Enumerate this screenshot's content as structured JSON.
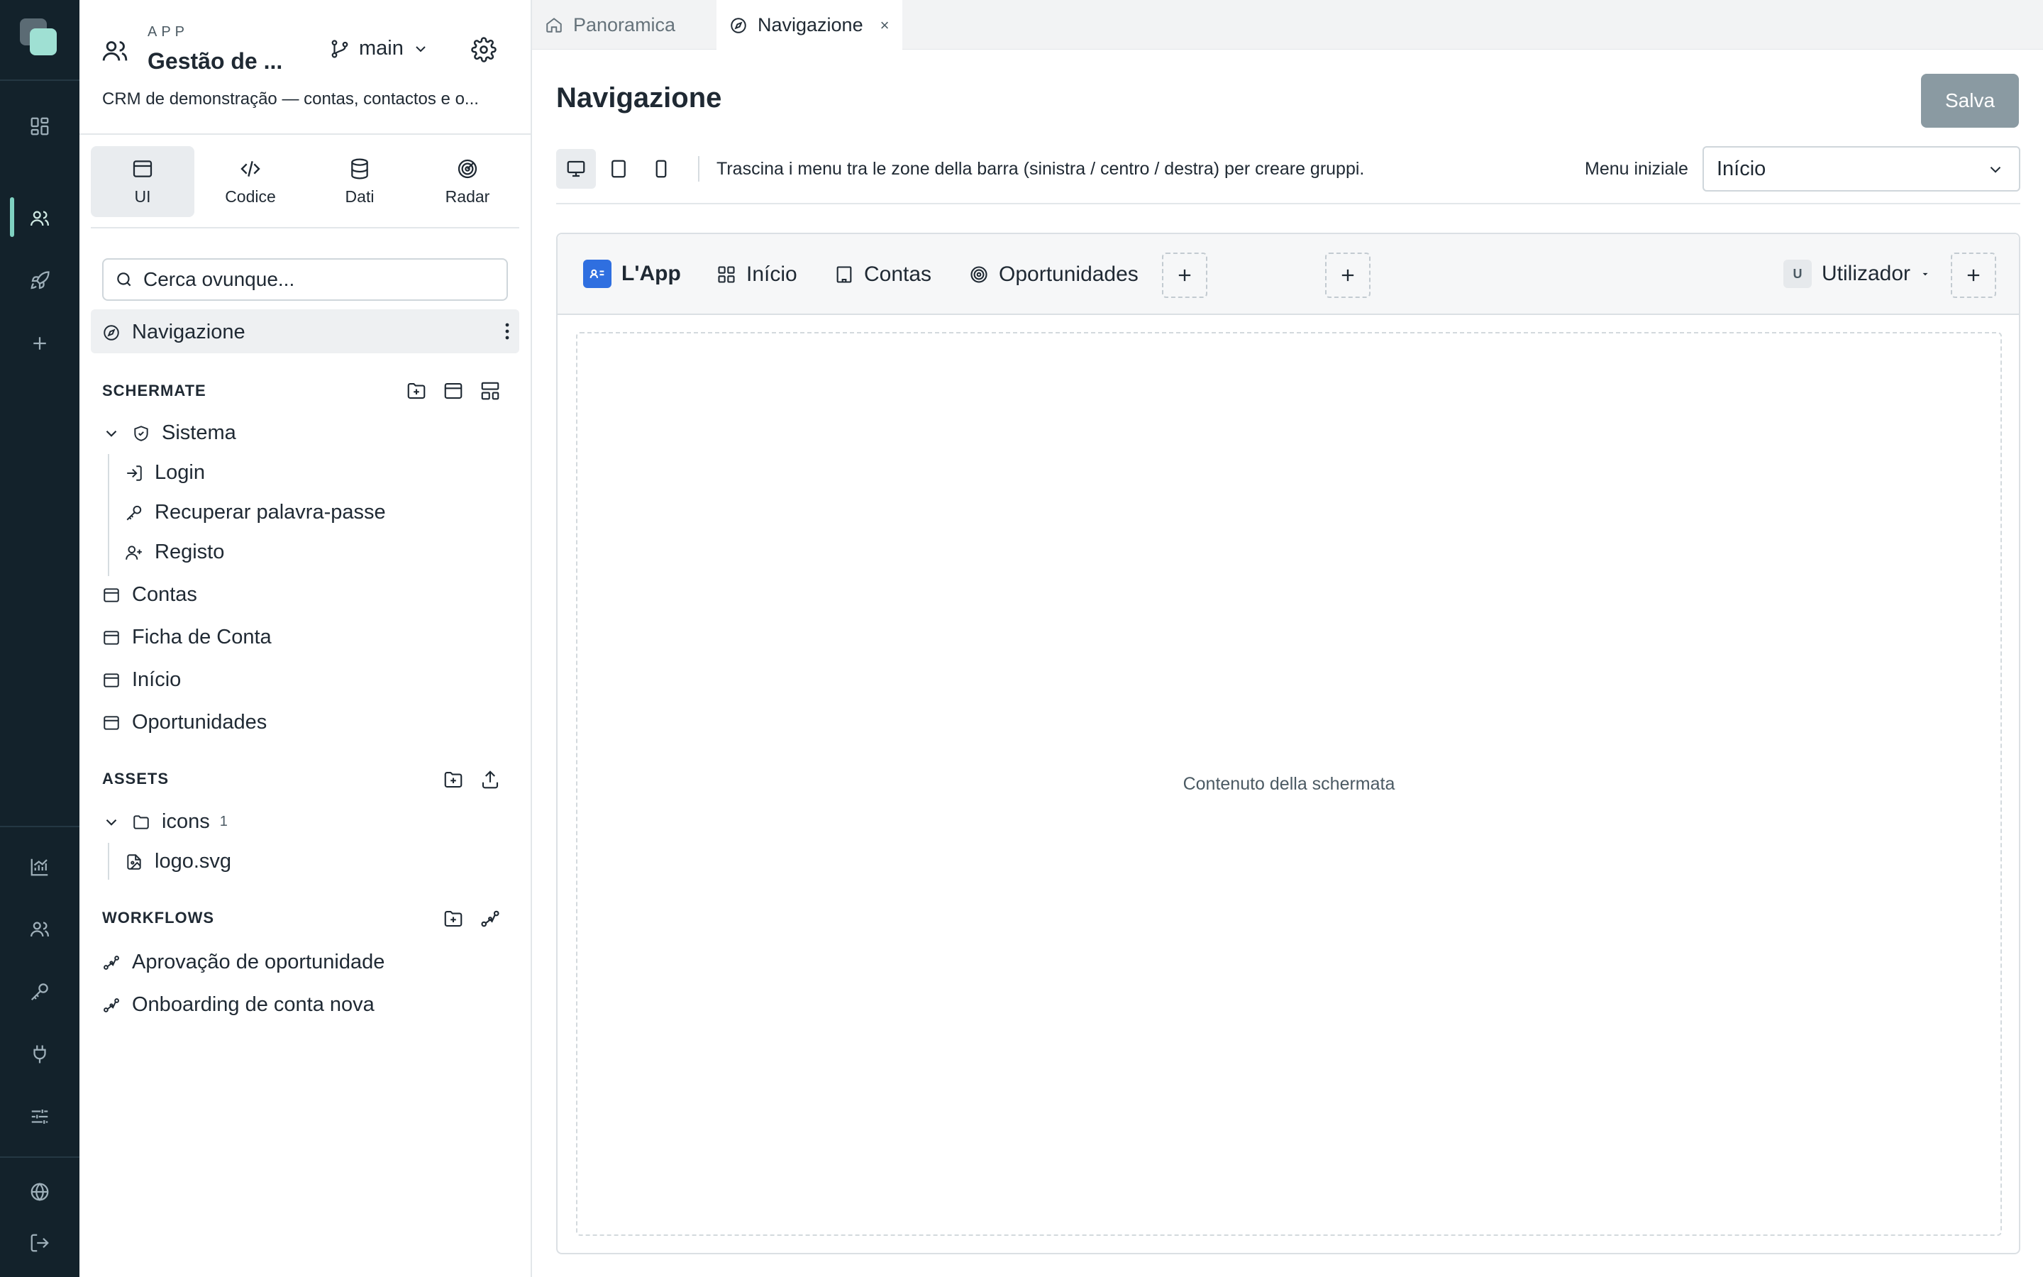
{
  "window": {
    "accent": "#7fd1c1",
    "rail_bg": "#13222b"
  },
  "app": {
    "eyebrow": "APP",
    "name": "Gestão de ...",
    "description": "CRM de demonstração — contas, contactos e o...",
    "branch": "main"
  },
  "sidebar_tabs": [
    {
      "label": "UI",
      "icon": "window-icon",
      "active": true
    },
    {
      "label": "Codice",
      "icon": "code-icon"
    },
    {
      "label": "Dati",
      "icon": "database-icon"
    },
    {
      "label": "Radar",
      "icon": "radar-icon"
    }
  ],
  "search": {
    "placeholder": "Cerca ovunque..."
  },
  "nav_item": {
    "label": "Navigazione"
  },
  "sections": {
    "screens": {
      "title": "SCHERMATE",
      "folder": "Sistema",
      "folder_items": [
        "Login",
        "Recuperar palavra-passe",
        "Registo"
      ],
      "items": [
        "Contas",
        "Ficha de Conta",
        "Início",
        "Oportunidades"
      ]
    },
    "assets": {
      "title": "ASSETS",
      "folder": "icons",
      "folder_count": "1",
      "files": [
        "logo.svg"
      ]
    },
    "workflows": {
      "title": "WORKFLOWS",
      "items": [
        "Aprovação de oportunidade",
        "Onboarding de conta nova"
      ]
    }
  },
  "tabs": [
    {
      "label": "Panoramica",
      "icon": "home-icon",
      "active": false
    },
    {
      "label": "Navigazione",
      "icon": "compass-icon",
      "active": true,
      "close": "×"
    }
  ],
  "main": {
    "title": "Navigazione",
    "save_label": "Salva",
    "hint": "Trascina i menu tra le zone della barra (sinistra / centro / destra) per creare gruppi.",
    "initial_menu_label": "Menu iniziale",
    "initial_menu_value": "Início"
  },
  "preview": {
    "brand": "L'App",
    "menus": [
      "Início",
      "Contas",
      "Oportunidades"
    ],
    "user_initial": "U",
    "user_label": "Utilizador",
    "content_placeholder": "Contenuto della schermata",
    "brand_color": "#2f6fe0"
  }
}
